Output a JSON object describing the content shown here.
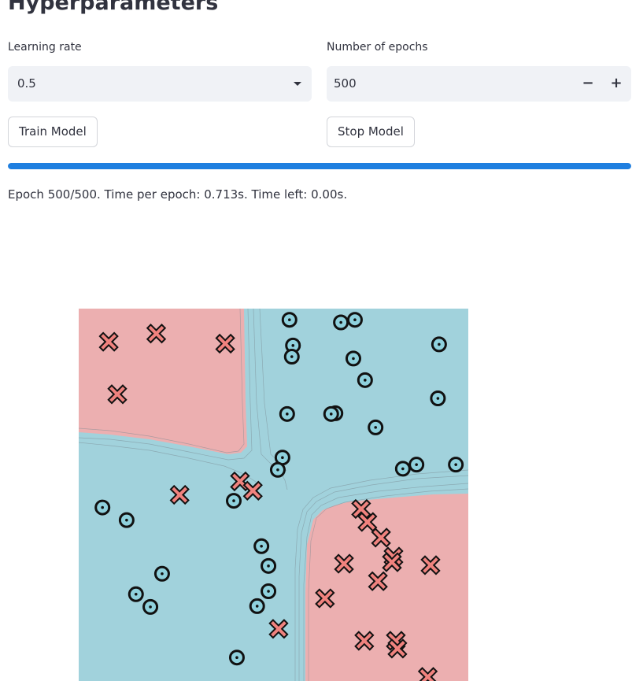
{
  "section_title": "Hyperparameters",
  "learning_rate": {
    "label": "Learning rate",
    "selected": "0.5"
  },
  "epochs": {
    "label": "Number of epochs",
    "value": "500",
    "minus": "−",
    "plus": "+"
  },
  "buttons": {
    "train": "Train Model",
    "stop": "Stop Model"
  },
  "progress": {
    "value": 1.0,
    "color": "#1f7fe0"
  },
  "status_text": "Epoch 500/500. Time per epoch: 0.713s. Time left: 0.00s.",
  "colors": {
    "region_a": "#ecafb0",
    "region_b": "#a1d2dc",
    "x_marker": "#f0827e",
    "o_marker": "#8fd1dd"
  },
  "icons": {
    "dropdown": "chevron-down-icon",
    "class_a": "x-marker",
    "class_b": "ring-dot-marker"
  },
  "chart_data": {
    "type": "scatter",
    "title": "",
    "xlabel": "",
    "ylabel": "",
    "xlim": [
      0,
      1
    ],
    "ylim": [
      0,
      1
    ],
    "series": [
      {
        "marker": "x",
        "points": [
          [
            0.077,
            0.911
          ],
          [
            0.199,
            0.933
          ],
          [
            0.376,
            0.906
          ],
          [
            0.099,
            0.77
          ],
          [
            0.259,
            0.5
          ],
          [
            0.414,
            0.536
          ],
          [
            0.447,
            0.511
          ],
          [
            0.725,
            0.462
          ],
          [
            0.741,
            0.427
          ],
          [
            0.776,
            0.385
          ],
          [
            0.681,
            0.315
          ],
          [
            0.808,
            0.334
          ],
          [
            0.804,
            0.319
          ],
          [
            0.903,
            0.311
          ],
          [
            0.768,
            0.268
          ],
          [
            0.632,
            0.222
          ],
          [
            0.513,
            0.14
          ],
          [
            0.733,
            0.108
          ],
          [
            0.814,
            0.108
          ],
          [
            0.818,
            0.087
          ],
          [
            0.896,
            0.011
          ]
        ]
      },
      {
        "marker": "o",
        "points": [
          [
            0.541,
            0.97
          ],
          [
            0.673,
            0.963
          ],
          [
            0.709,
            0.97
          ],
          [
            0.55,
            0.901
          ],
          [
            0.547,
            0.871
          ],
          [
            0.705,
            0.866
          ],
          [
            0.735,
            0.808
          ],
          [
            0.925,
            0.904
          ],
          [
            0.922,
            0.759
          ],
          [
            0.535,
            0.717
          ],
          [
            0.659,
            0.719
          ],
          [
            0.648,
            0.717
          ],
          [
            0.762,
            0.681
          ],
          [
            0.523,
            0.6
          ],
          [
            0.511,
            0.567
          ],
          [
            0.832,
            0.57
          ],
          [
            0.867,
            0.581
          ],
          [
            0.968,
            0.581
          ],
          [
            0.398,
            0.484
          ],
          [
            0.061,
            0.466
          ],
          [
            0.123,
            0.432
          ],
          [
            0.469,
            0.362
          ],
          [
            0.487,
            0.309
          ],
          [
            0.214,
            0.288
          ],
          [
            0.487,
            0.241
          ],
          [
            0.147,
            0.233
          ],
          [
            0.184,
            0.199
          ],
          [
            0.458,
            0.201
          ],
          [
            0.406,
            0.063
          ]
        ]
      }
    ]
  }
}
